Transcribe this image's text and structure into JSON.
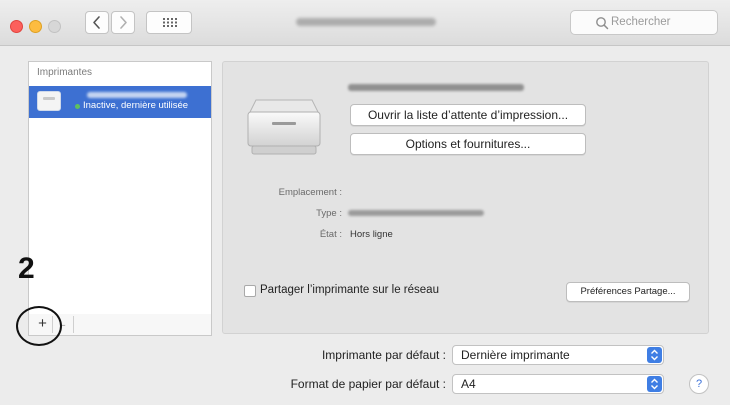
{
  "toolbar": {
    "search_placeholder": "Rechercher"
  },
  "printers": {
    "header": "Imprimantes",
    "items": [
      {
        "status": "Inactive, dernière utilisée",
        "selected": true
      }
    ],
    "add_label": "+",
    "remove_label": "-"
  },
  "annotation": {
    "step": "2"
  },
  "detail": {
    "open_queue_label": "Ouvrir la liste d’attente d’impression...",
    "options_label": "Options et fournitures...",
    "location_label": "Emplacement :",
    "type_label": "Type :",
    "state_label": "État :",
    "state_value": "Hors ligne",
    "share_label": "Partager l’imprimante sur le réseau",
    "share_checked": false,
    "share_prefs_label": "Préférences Partage..."
  },
  "defaults": {
    "default_printer_label": "Imprimante par défaut :",
    "default_printer_value": "Dernière imprimante",
    "default_paper_label": "Format de papier par défaut :",
    "default_paper_value": "A4"
  },
  "help": {
    "label": "?"
  },
  "colors": {
    "selection": "#3d70d2",
    "accent": "#3f7ee4",
    "status_idle": "#5ec15e"
  }
}
